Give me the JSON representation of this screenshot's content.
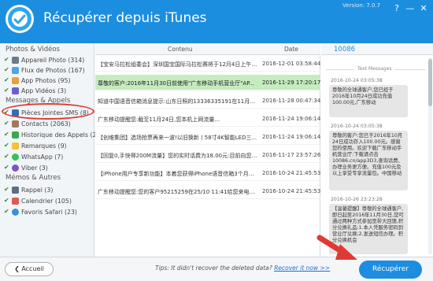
{
  "header": {
    "title": "Récupérer depuis iTunes",
    "version": "Version: 7.0.7",
    "help_icon": "?",
    "minimize_icon": "—",
    "close_icon": "✕"
  },
  "sidebar": {
    "photos_heading": "Photos & Vidéos",
    "photos_items": [
      {
        "label": "Appareil Photo (314)",
        "icon": "camera-icon"
      },
      {
        "label": "Flux de Photos (167)",
        "icon": "cloud-icon"
      },
      {
        "label": "App Photos (95)",
        "icon": "photos-icon"
      },
      {
        "label": "App Vidéos (3)",
        "icon": "video-icon"
      }
    ],
    "messages_heading": "Messages & Appels",
    "messages_items": [
      {
        "label": "Pièces Jointes SMS (8)",
        "icon": "paperclip-icon"
      },
      {
        "label": "Contacts (2063)",
        "icon": "contacts-icon"
      },
      {
        "label": "Historique des Appels (20)",
        "icon": "phone-icon"
      },
      {
        "label": "Remarques (9)",
        "icon": "notes-icon"
      },
      {
        "label": "WhatsApp (7)",
        "icon": "whatsapp-icon"
      },
      {
        "label": "Viber (3)",
        "icon": "viber-icon"
      }
    ],
    "memos_heading": "Mémos & Autres",
    "memos_items": [
      {
        "label": "Rappel (3)",
        "icon": "bell-icon"
      },
      {
        "label": "Calendrier (105)",
        "icon": "calendar-icon"
      },
      {
        "label": "Favoris Safari (23)",
        "icon": "safari-icon"
      }
    ]
  },
  "list": {
    "col_content": "Contenu",
    "col_date": "Date",
    "rows": [
      {
        "text": "【宝安马拉松组委会】深圳国宝国际马拉松赛将于12月4日上午7:...",
        "date": "2016-12-01 03:58:44"
      },
      {
        "text": "尊敬的客户:2016年11月30日前使用\"广东移动手机营业厅\"AP...",
        "date": "2016-11-29 17:20:17"
      },
      {
        "text": "知道中国语音信箱消息提示:山东日照的13336335191在11月28...",
        "date": "2016-11-28 00:47:34"
      },
      {
        "text": "广东移动提醒您:截至11月24日,您本机上网流量...",
        "date": "2016-11-24 19:06:14"
      },
      {
        "text": "【创维集团】选场抢票再来一波!以旧换新丨58寸4K智能LED三...",
        "date": "2016-11-24 19:06:14"
      },
      {
        "text": "【回复0,手快得200M流量】您的实时话费为18.00元:目前向您推...",
        "date": "2016-11-17 23:57:26"
      },
      {
        "text": "【iPhone用户专享新功能】本着您获得iPhone语音信箱3个月免费...",
        "date": "2016-10-24 21:45:53"
      },
      {
        "text": "广东移动提醒您:您的客户95215259在25/10 11:41给您来电话...",
        "date": "2016-10-24 21:45:53"
      }
    ]
  },
  "detail": {
    "phone_number": "10086",
    "section_label": "Text Messages",
    "messages": [
      {
        "time": "2016-10-24 03:05:38",
        "text": "尊敬的全球通客户,您已经于2016年10月24日成功充值100.00元,广东移动"
      },
      {
        "time": "2016-10-24 03:05:38",
        "text": "尊敬的客户:您已于2016年10月24日成功存入100.00元。感谢您的使用。欢迎下载广东移动手机营业厅:下载请点击10086.cn/app3D3,查询话费、办理业务更方便。充值100元及以上享受专享流量包。中国移动"
      },
      {
        "time": "2016-10-26 23:23:28",
        "text": "【温馨提醒】尊敬的全球通客户,即日起至2016年11月30日,您可通过两种方式参加宽带大回馈,积分兑换礼品:1.本人凭服务密码到营业厅兑换;2.发送短信办理。积分兑换机会"
      }
    ]
  },
  "footer": {
    "back_label": "Accueil",
    "tips_prefix": "Tips: It didn't recover the deleted data?",
    "tips_link": "Recover it now >>",
    "recover_label": "Récupérer"
  }
}
